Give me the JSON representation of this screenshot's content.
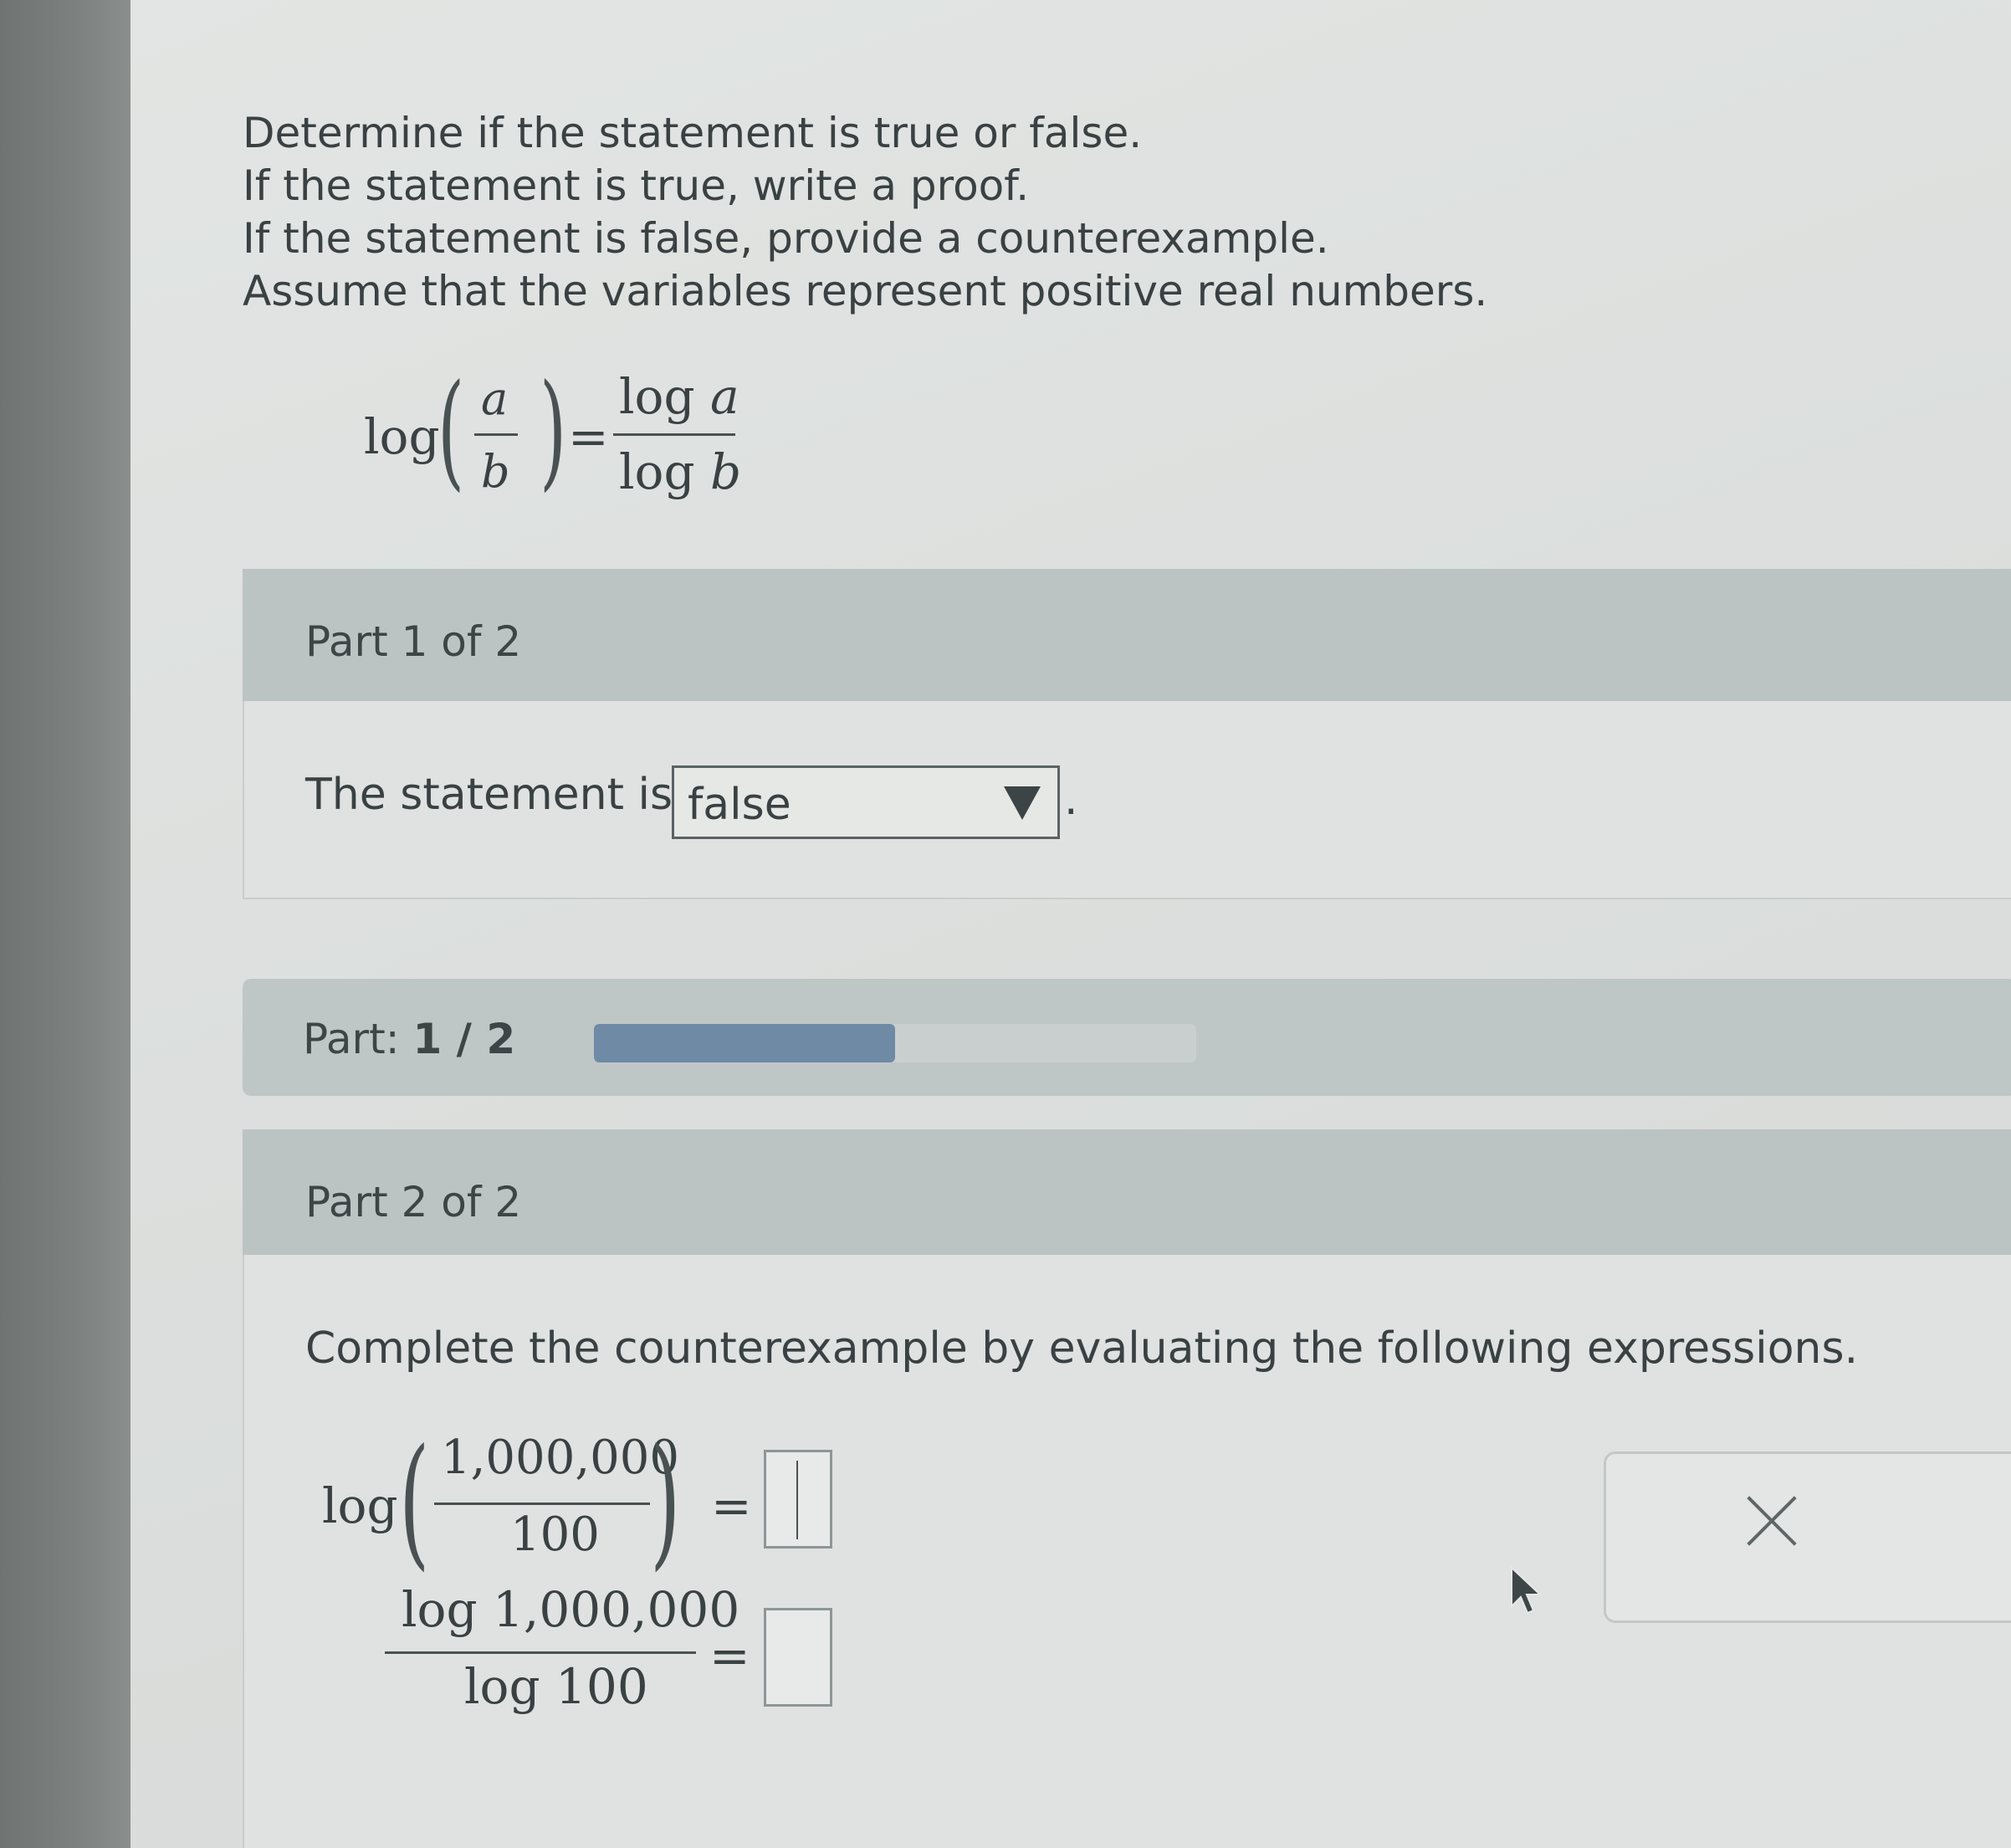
{
  "instructions": [
    "Determine if the statement is true or false.",
    "If the statement is true, write a proof.",
    "If the statement is false, provide a counterexample.",
    "Assume that the variables represent positive real numbers."
  ],
  "statement": {
    "lhs_func": "log",
    "lhs_num": "a",
    "lhs_den": "b",
    "equals": "=",
    "rhs_num_func": "log",
    "rhs_num_var": "a",
    "rhs_den_func": "log",
    "rhs_den_var": "b"
  },
  "part1": {
    "header": "Part 1 of 2",
    "label": "The statement is",
    "select_value": "false",
    "period": "."
  },
  "progress": {
    "label_prefix": "Part:",
    "label_value": "1 / 2",
    "current": 1,
    "total": 2
  },
  "part2": {
    "header": "Part 2 of 2",
    "instruction": "Complete the counterexample by evaluating the following expressions.",
    "expr1": {
      "func": "log",
      "num": "1,000,000",
      "den": "100",
      "equals": "="
    },
    "expr2": {
      "num": "log 1,000,000",
      "den": "log 100",
      "equals": "="
    },
    "answer1": "",
    "answer2": ""
  },
  "icons": {
    "dropdown": "triangle-down-icon",
    "clear": "close-icon",
    "pointer": "mouse-pointer-icon"
  },
  "colors": {
    "progress_fill": "#6e8aa4",
    "header_bg": "#bcc3c3"
  }
}
